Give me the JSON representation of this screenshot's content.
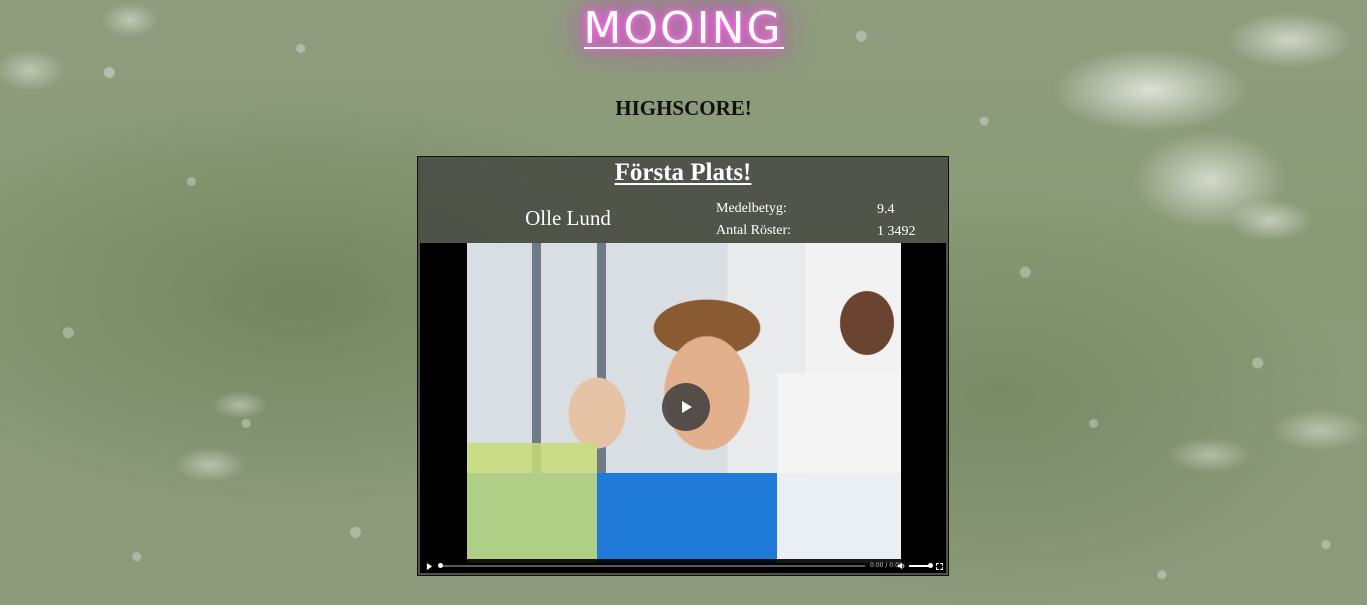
{
  "header": {
    "logo_text": "MOOING",
    "subtitle": "HIGHSCORE!"
  },
  "card": {
    "title": "Första Plats!",
    "player_name": "Olle Lund",
    "stats": [
      {
        "label": "Medelbetyg:",
        "value": "9.4"
      },
      {
        "label": "Antal Röster:",
        "value": "1 3492"
      }
    ]
  },
  "video_player": {
    "time_display": "0:00 / 0:00",
    "play_icon": "play-icon",
    "volume_icon": "speaker-icon",
    "fullscreen_icon": "fullscreen-icon",
    "progress": 0,
    "volume": 1
  },
  "colors": {
    "logo_glow": "#ff4fe6",
    "card_background": "#46483f",
    "text_light": "#ffffff",
    "text_dark": "#111111"
  }
}
